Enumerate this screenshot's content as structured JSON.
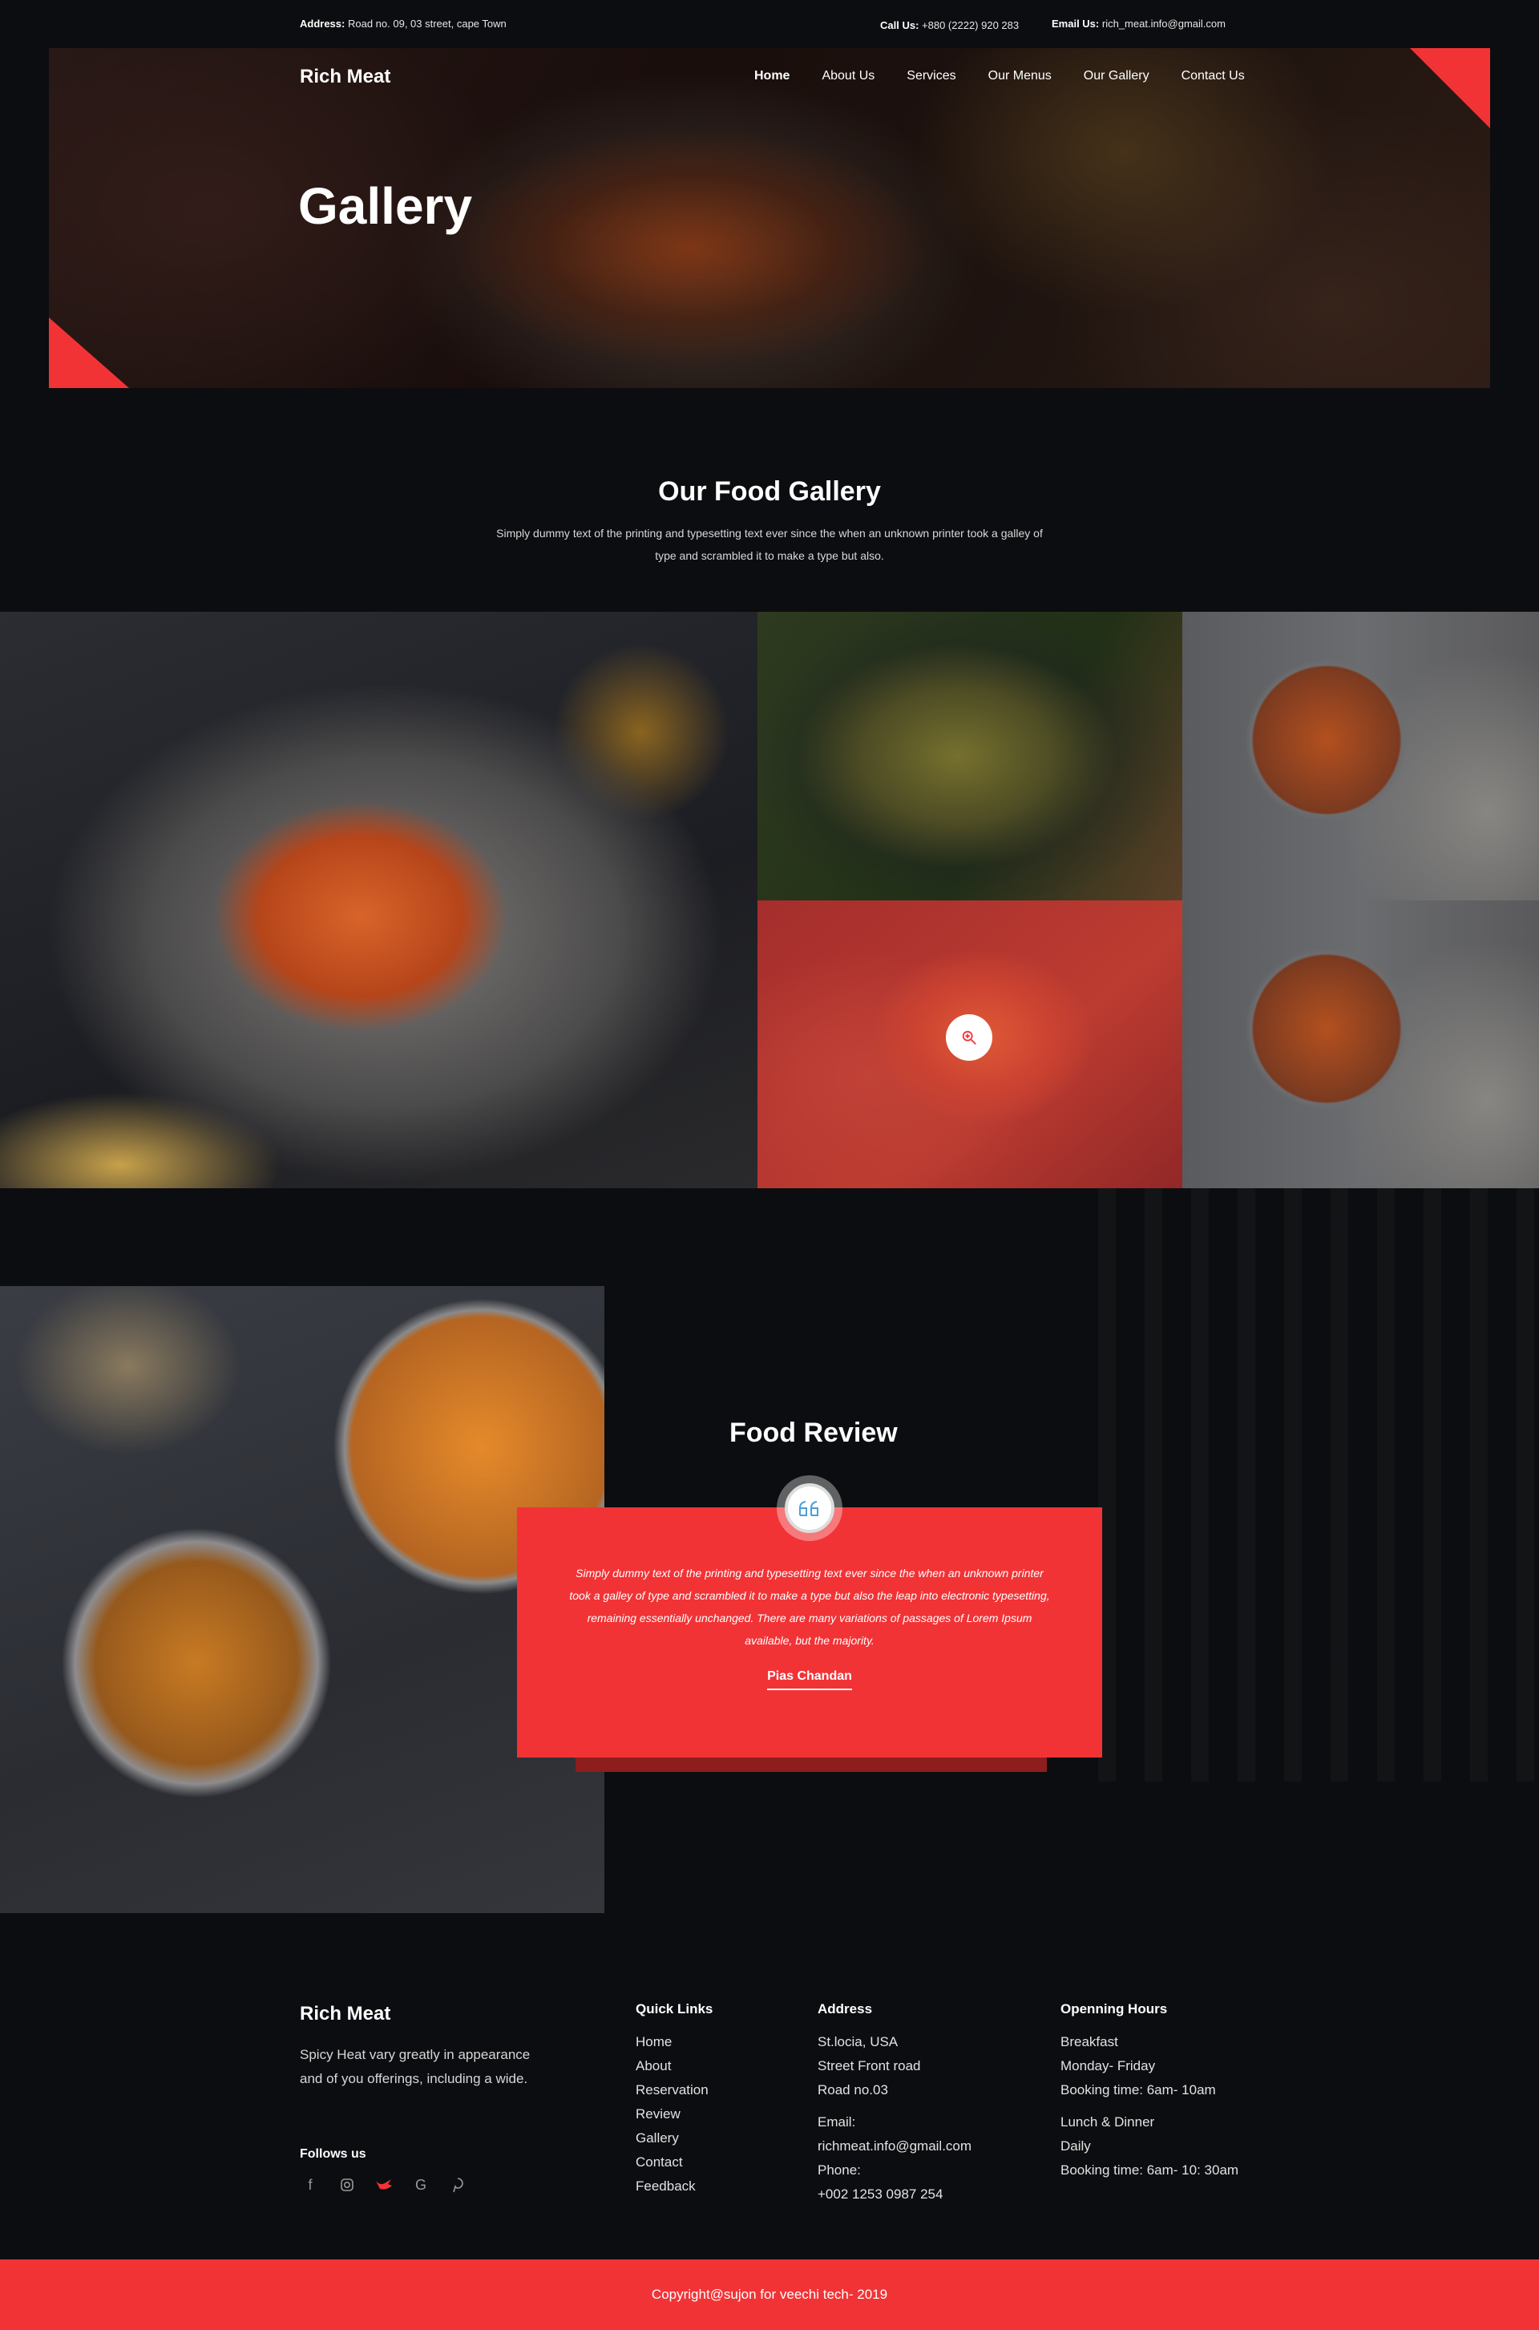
{
  "topbar": {
    "address_label": "Address:",
    "address": "Road no. 09, 03 street, cape Town",
    "call_label": "Call Us:",
    "call": "+880 (2222) 920 283",
    "email_label": "Email Us:",
    "email": "rich_meat.info@gmail.com"
  },
  "header": {
    "brand": "Rich Meat",
    "nav": [
      "Home",
      "About Us",
      "Services",
      "Our Menus",
      "Our Gallery",
      "Contact Us"
    ],
    "active_nav": "Home",
    "page_title": "Gallery"
  },
  "gallery": {
    "title": "Our Food Gallery",
    "description": "Simply dummy text of the printing and typesetting text ever since the when an unknown printer took a galley of type and scrambled it to make a type but also."
  },
  "review": {
    "title": "Food Review",
    "text": "Simply dummy text of the printing and typesetting text ever since the when an unknown printer took a galley of type and scrambled it to make a type but also the leap into electronic typesetting, remaining essentially unchanged. There are many variations of passages of Lorem Ipsum available, but the majority.",
    "author": "Pias Chandan"
  },
  "footer": {
    "brand": "Rich Meat",
    "description": "Spicy Heat vary greatly in appearance and of you offerings, including a wide.",
    "follow_title": "Follows us",
    "social_icons": [
      "facebook-icon",
      "instagram-icon",
      "twitter-icon",
      "google-icon",
      "pinterest-icon"
    ],
    "quick_links": {
      "title": "Quick Links",
      "items": [
        "Home",
        "About",
        "Reservation",
        "Review",
        "Gallery",
        "Contact",
        "Feedback"
      ]
    },
    "address": {
      "title": "Address",
      "lines": [
        "St.locia, USA",
        "Street Front road",
        "Road no.03"
      ],
      "email_label": "Email:",
      "email": "richmeat.info@gmail.com",
      "phone_label": "Phone:",
      "phone": "+002 1253 0987 254"
    },
    "hours": {
      "title": "Openning Hours",
      "breakfast": [
        "Breakfast",
        "Monday- Friday",
        "Booking time: 6am- 10am"
      ],
      "dinner": [
        "Lunch & Dinner",
        "Daily",
        "Booking time: 6am- 10: 30am"
      ]
    },
    "copyright": "Copyright@sujon for veechi tech- 2019"
  },
  "colors": {
    "accent": "#f23336",
    "background": "#0c0d10"
  }
}
